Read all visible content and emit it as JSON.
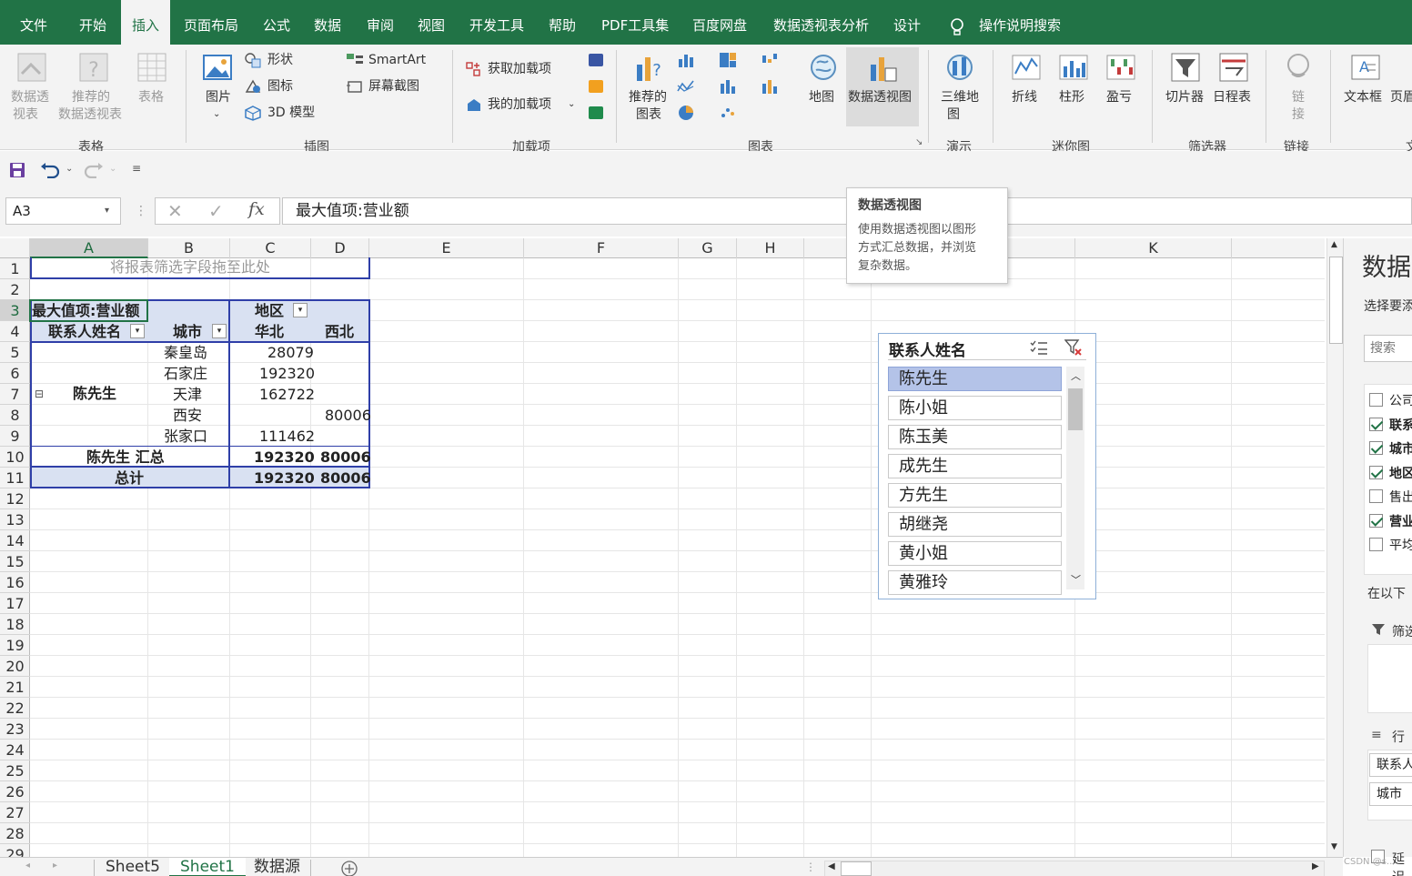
{
  "menu": {
    "items": [
      "文件",
      "开始",
      "插入",
      "页面布局",
      "公式",
      "数据",
      "审阅",
      "视图",
      "开发工具",
      "帮助",
      "PDF工具集",
      "百度网盘",
      "数据透视表分析",
      "设计"
    ],
    "active": "插入",
    "search_label": "操作说明搜索"
  },
  "ribbon": {
    "tables": {
      "group": "表格",
      "pivot_table": [
        "数据透",
        "视表"
      ],
      "recommended": [
        "推荐的",
        "数据透视表"
      ],
      "table": "表格"
    },
    "illustrations": {
      "group": "插图",
      "pictures": "图片",
      "shapes": "形状",
      "icons": "图标",
      "models": "3D 模型",
      "smartart": "SmartArt",
      "screenshot": "屏幕截图"
    },
    "addins": {
      "group": "加载项",
      "get": "获取加载项",
      "my": "我的加载项"
    },
    "charts": {
      "group": "图表",
      "recommended": [
        "推荐的",
        "图表"
      ],
      "map": "地图",
      "pivot_chart": "数据透视图"
    },
    "tours": {
      "group": "演示",
      "map3d": [
        "三维地",
        "图"
      ]
    },
    "sparklines": {
      "group": "迷你图",
      "line": "折线",
      "column": "柱形",
      "winloss": "盈亏"
    },
    "filters": {
      "group": "筛选器",
      "slicer": "切片器",
      "timeline": "日程表"
    },
    "links": {
      "group": "链接",
      "link": [
        "链",
        "接"
      ]
    },
    "text": {
      "group": "文",
      "textbox": "文本框",
      "header": "页眉"
    }
  },
  "formula_bar": {
    "name_box": "A3",
    "formula": "最大值项:营业额",
    "fx": "fx"
  },
  "tooltip": {
    "title": "数据透视图",
    "lines": [
      "使用数据透视图以图形",
      "方式汇总数据，并浏览",
      "复杂数据。"
    ]
  },
  "columns": [
    "A",
    "B",
    "C",
    "D",
    "E",
    "F",
    "G",
    "H",
    "",
    "",
    "K"
  ],
  "rows": [
    "1",
    "2",
    "3",
    "4",
    "5",
    "6",
    "7",
    "8",
    "9",
    "10",
    "11",
    "12",
    "13",
    "14",
    "15",
    "16",
    "17",
    "18",
    "19",
    "20",
    "21",
    "22",
    "23",
    "24",
    "25",
    "26",
    "27",
    "28",
    "29"
  ],
  "pivot": {
    "filter_hint": "将报表筛选字段拖至此处",
    "value_field": "最大值项:营业额",
    "col_field": "地区",
    "row_field1": "联系人姓名",
    "row_field2": "城市",
    "col_items": [
      "华北",
      "西北"
    ],
    "group_name": "陈先生",
    "expander": "⊟",
    "rows": [
      {
        "city": "秦皇岛",
        "north": "28079",
        "west": ""
      },
      {
        "city": "石家庄",
        "north": "192320",
        "west": ""
      },
      {
        "city": "天津",
        "north": "162722",
        "west": ""
      },
      {
        "city": "西安",
        "north": "",
        "west": "80006"
      },
      {
        "city": "张家口",
        "north": "111462",
        "west": ""
      }
    ],
    "subtotal": {
      "label": "陈先生 汇总",
      "north": "192320",
      "west": "80006"
    },
    "total": {
      "label": "总计",
      "north": "192320",
      "west": "80006"
    }
  },
  "slicer": {
    "title": "联系人姓名",
    "items": [
      "陈先生",
      "陈小姐",
      "陈玉美",
      "成先生",
      "方先生",
      "胡继尧",
      "黄小姐",
      "黄雅玲"
    ],
    "selected": "陈先生"
  },
  "field_pane": {
    "title": "数据",
    "subtitle": "选择要添",
    "search_placeholder": "搜索",
    "fields": [
      {
        "label": "公司",
        "checked": false
      },
      {
        "label": "联系",
        "checked": true
      },
      {
        "label": "城市",
        "checked": true
      },
      {
        "label": "地区",
        "checked": true
      },
      {
        "label": "售出",
        "checked": false
      },
      {
        "label": "营业",
        "checked": true
      },
      {
        "label": "平均",
        "checked": false
      }
    ],
    "areas_label": "在以下",
    "filter_area": "筛选",
    "rows_area": "行",
    "row_items": [
      "联系人",
      "城市"
    ],
    "defer": "延迟"
  },
  "sheets": {
    "tabs": [
      "Sheet5",
      "Sheet1",
      "数据源"
    ],
    "active": "Sheet1"
  },
  "watermark": "CSDN @s..."
}
